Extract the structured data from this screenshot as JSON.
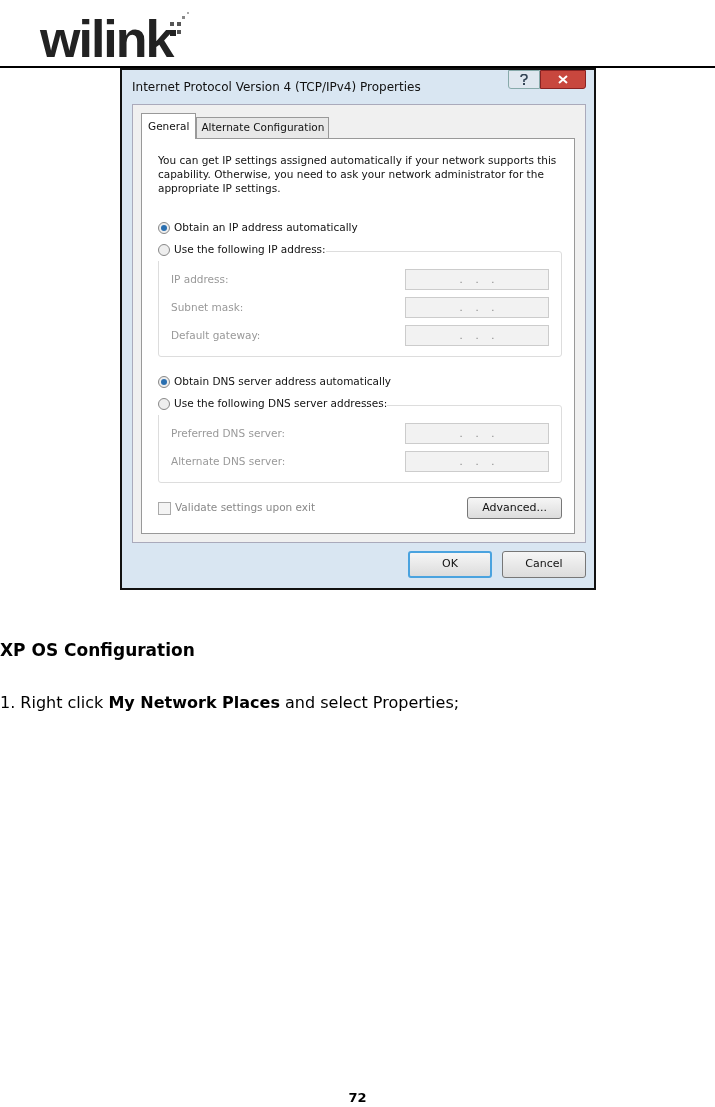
{
  "header": {
    "logo": "wilink"
  },
  "dialog": {
    "title": "Internet Protocol Version 4 (TCP/IPv4) Properties",
    "tabs": [
      {
        "label": "General",
        "selected": true
      },
      {
        "label": "Alternate Configuration",
        "selected": false
      }
    ],
    "intro": "You can get IP settings assigned automatically if your network supports this capability. Otherwise, you need to ask your network administrator for the appropriate IP settings.",
    "ip_options": [
      {
        "label": "Obtain an IP address automatically",
        "selected": true
      },
      {
        "label": "Use the following IP address:",
        "selected": false
      }
    ],
    "ip_fields": [
      {
        "label": "IP address:",
        "value": ".    .    .",
        "disabled": true
      },
      {
        "label": "Subnet mask:",
        "value": ".    .    .",
        "disabled": true
      },
      {
        "label": "Default gateway:",
        "value": ".    .    .",
        "disabled": true
      }
    ],
    "dns_options": [
      {
        "label": "Obtain DNS server address automatically",
        "selected": true
      },
      {
        "label": "Use the following DNS server addresses:",
        "selected": false
      }
    ],
    "dns_fields": [
      {
        "label": "Preferred DNS server:",
        "value": ".    .    .",
        "disabled": true
      },
      {
        "label": "Alternate DNS server:",
        "value": ".    .    .",
        "disabled": true
      }
    ],
    "validate": {
      "label": "Validate settings upon exit",
      "checked": false,
      "disabled": true
    },
    "advanced_button": "Advanced...",
    "buttons": [
      {
        "label": "OK",
        "default": true
      },
      {
        "label": "Cancel",
        "default": false
      }
    ]
  },
  "doc": {
    "heading": "XP OS Configuration",
    "step": "1. Right click **My Network Places** and select Properties;"
  },
  "page_number": "72"
}
